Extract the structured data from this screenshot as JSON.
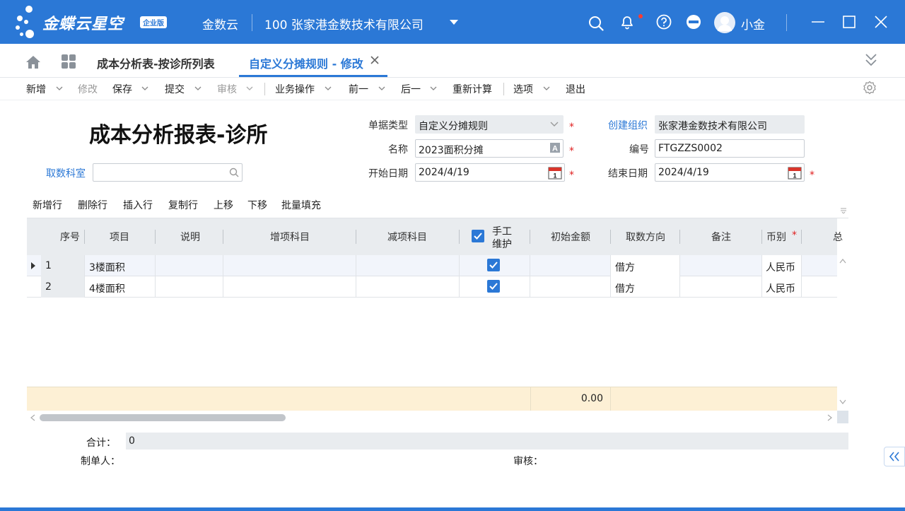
{
  "app": {
    "brand": "金蝶云星空",
    "edition": "企业版",
    "cloud_name": "金数云",
    "org": "100  张家港金数技术有限公司",
    "user": "小金"
  },
  "tabs": [
    {
      "label": "成本分析表-按诊所列表"
    },
    {
      "label": "自定义分摊规则 - 修改"
    }
  ],
  "toolbar": {
    "new": "新增",
    "modify": "修改",
    "save": "保存",
    "submit": "提交",
    "audit": "审核",
    "business": "业务操作",
    "prev": "前一",
    "next": "后一",
    "recalc": "重新计算",
    "options": "选项",
    "exit": "退出"
  },
  "form": {
    "title": "成本分析报表-诊所",
    "dept_label": "取数科室",
    "dept_value": "",
    "bill_type_label": "单据类型",
    "bill_type_value": "自定义分摊规则",
    "create_org_label": "创建组织",
    "create_org_value": "张家港金数技术有限公司",
    "name_label": "名称",
    "name_value": "2023面积分摊",
    "number_label": "编号",
    "number_value": "FTGZZS0002",
    "start_label": "开始日期",
    "start_value": "2024/4/19",
    "end_label": "结束日期",
    "end_value": "2024/4/19",
    "required_mark": "*"
  },
  "grid_tools": {
    "add_row": "新增行",
    "delete_row": "删除行",
    "insert_row": "插入行",
    "copy_row": "复制行",
    "move_up": "上移",
    "move_down": "下移",
    "batch_fill": "批量填充"
  },
  "grid": {
    "headers": {
      "seq": "序号",
      "item": "项目",
      "desc": "说明",
      "add_subject": "增项科目",
      "sub_subject": "减项科目",
      "manual_1": "手工",
      "manual_2": "维护",
      "init_amount": "初始金额",
      "direction": "取数方向",
      "remark": "备注",
      "currency": "币别",
      "more": "总"
    },
    "rows": [
      {
        "seq": "1",
        "item": "3楼面积",
        "desc": "",
        "add_subject": "",
        "sub_subject": "",
        "manual": true,
        "init_amount": "",
        "direction": "借方",
        "remark": "",
        "currency": "人民币"
      },
      {
        "seq": "2",
        "item": "4楼面积",
        "desc": "",
        "add_subject": "",
        "sub_subject": "",
        "manual": true,
        "init_amount": "",
        "direction": "借方",
        "remark": "",
        "currency": "人民币"
      }
    ],
    "total_amount": "0.00"
  },
  "footer": {
    "total_label": "合计：",
    "total_value": "0",
    "maker_label": "制单人：",
    "auditor_label": "审核："
  },
  "colors": {
    "brand_blue": "#2b78d6",
    "required_red": "#e02020",
    "total_row_bg": "#fdf0d5"
  },
  "icons": [
    "search-icon",
    "bell-icon",
    "help-icon",
    "minus-circle-icon",
    "avatar",
    "minimize-icon",
    "maximize-icon",
    "close-icon",
    "home-icon",
    "apps-icon",
    "chevron-double-down-icon",
    "gear-icon",
    "calendar-icon",
    "lookup-icon"
  ]
}
